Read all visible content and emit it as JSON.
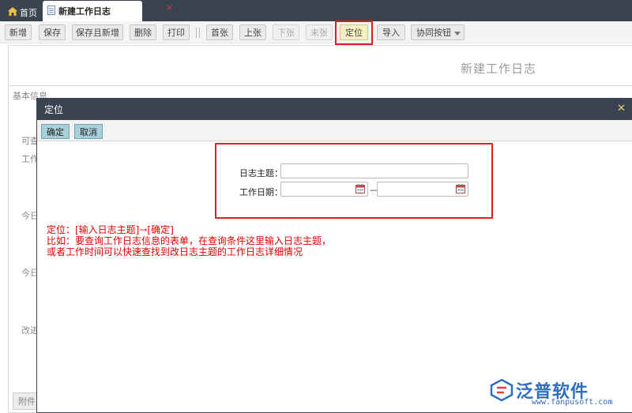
{
  "tabs": {
    "home_label": "首页",
    "active_label": "新建工作日志",
    "close_glyph": "×"
  },
  "toolbar": {
    "buttons": [
      {
        "label": "新增",
        "state": "normal"
      },
      {
        "label": "保存",
        "state": "normal"
      },
      {
        "label": "保存且新增",
        "state": "normal"
      },
      {
        "label": "删除",
        "state": "normal"
      },
      {
        "label": "打印",
        "state": "normal"
      },
      {
        "label": "首张",
        "state": "normal"
      },
      {
        "label": "上张",
        "state": "normal"
      },
      {
        "label": "下张",
        "state": "disabled"
      },
      {
        "label": "末张",
        "state": "disabled"
      },
      {
        "label": "定位",
        "state": "active"
      },
      {
        "label": "导入",
        "state": "normal"
      },
      {
        "label": "协同按钮",
        "state": "normal"
      }
    ]
  },
  "form": {
    "title": "新建工作日志",
    "section_label": "基本信息",
    "partial_labels": [
      "可查",
      "工作",
      "今日",
      "今日",
      "改进"
    ],
    "attach_label": "附件"
  },
  "modal": {
    "title": "定位",
    "close_glyph": "✕",
    "confirm_label": "确定",
    "cancel_label": "取消",
    "subject_label": "日志主题：",
    "subject_value": "",
    "date_label": "工作日期：",
    "date_from": "",
    "date_to": "",
    "date_sep": "—"
  },
  "note": {
    "line1": "定位：[输入日志主题]→[确定]",
    "line2": "比如：要查询工作日志信息的表单，在查询条件这里输入日志主题，",
    "line3": "或者工作时间可以快速查找到改日志主题的工作日志详细情况"
  },
  "logo": {
    "name": "泛普软件",
    "url": "www.fanpusoft.com"
  },
  "colors": {
    "topbar": "#3a4450",
    "highlight_red": "#e02020",
    "brand_blue": "#2f6ebd",
    "confirm_btn": "#a8d0d8"
  }
}
